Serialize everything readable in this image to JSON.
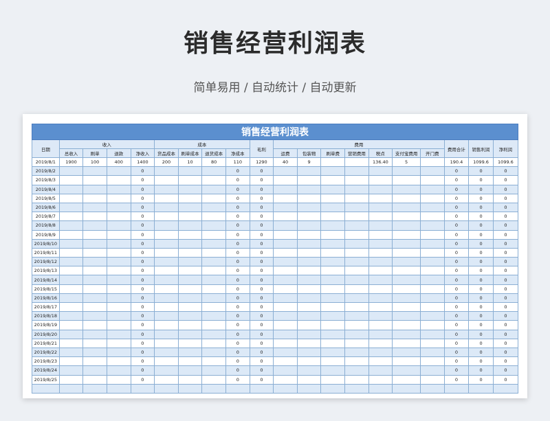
{
  "heading": "销售经营利润表",
  "subtitle": "简单易用 / 自动统计 / 自动更新",
  "table": {
    "title": "销售经营利润表",
    "groups": {
      "date": "日期",
      "income": "收入",
      "cost": "成本",
      "gross": "毛利",
      "expense": "费用",
      "expense_total": "费用合计",
      "sales_profit": "销售利润",
      "net_profit": "净利润"
    },
    "sub_headers": [
      "总收入",
      "刷单",
      "退款",
      "净收入",
      "货品成本",
      "刷单成本",
      "退货成本",
      "净成本",
      "运费",
      "包装物",
      "刷单费",
      "营销费用",
      "税点",
      "支付宝费用",
      "开门费"
    ],
    "rows": [
      [
        "2019/8/1",
        "1900",
        "100",
        "400",
        "1400",
        "200",
        "10",
        "80",
        "110",
        "1290",
        "40",
        "9",
        "",
        "",
        "136.40",
        "5",
        "",
        "190.4",
        "1099.6",
        "1099.6"
      ],
      [
        "2019/8/2",
        "",
        "",
        "",
        "0",
        "",
        "",
        "",
        "0",
        "0",
        "",
        "",
        "",
        "",
        "",
        "",
        "",
        "0",
        "0",
        "0"
      ],
      [
        "2019/8/3",
        "",
        "",
        "",
        "0",
        "",
        "",
        "",
        "0",
        "0",
        "",
        "",
        "",
        "",
        "",
        "",
        "",
        "0",
        "0",
        "0"
      ],
      [
        "2019/8/4",
        "",
        "",
        "",
        "0",
        "",
        "",
        "",
        "0",
        "0",
        "",
        "",
        "",
        "",
        "",
        "",
        "",
        "0",
        "0",
        "0"
      ],
      [
        "2019/8/5",
        "",
        "",
        "",
        "0",
        "",
        "",
        "",
        "0",
        "0",
        "",
        "",
        "",
        "",
        "",
        "",
        "",
        "0",
        "0",
        "0"
      ],
      [
        "2019/8/6",
        "",
        "",
        "",
        "0",
        "",
        "",
        "",
        "0",
        "0",
        "",
        "",
        "",
        "",
        "",
        "",
        "",
        "0",
        "0",
        "0"
      ],
      [
        "2019/8/7",
        "",
        "",
        "",
        "0",
        "",
        "",
        "",
        "0",
        "0",
        "",
        "",
        "",
        "",
        "",
        "",
        "",
        "0",
        "0",
        "0"
      ],
      [
        "2019/8/8",
        "",
        "",
        "",
        "0",
        "",
        "",
        "",
        "0",
        "0",
        "",
        "",
        "",
        "",
        "",
        "",
        "",
        "0",
        "0",
        "0"
      ],
      [
        "2019/8/9",
        "",
        "",
        "",
        "0",
        "",
        "",
        "",
        "0",
        "0",
        "",
        "",
        "",
        "",
        "",
        "",
        "",
        "0",
        "0",
        "0"
      ],
      [
        "2019/8/10",
        "",
        "",
        "",
        "0",
        "",
        "",
        "",
        "0",
        "0",
        "",
        "",
        "",
        "",
        "",
        "",
        "",
        "0",
        "0",
        "0"
      ],
      [
        "2019/8/11",
        "",
        "",
        "",
        "0",
        "",
        "",
        "",
        "0",
        "0",
        "",
        "",
        "",
        "",
        "",
        "",
        "",
        "0",
        "0",
        "0"
      ],
      [
        "2019/8/12",
        "",
        "",
        "",
        "0",
        "",
        "",
        "",
        "0",
        "0",
        "",
        "",
        "",
        "",
        "",
        "",
        "",
        "0",
        "0",
        "0"
      ],
      [
        "2019/8/13",
        "",
        "",
        "",
        "0",
        "",
        "",
        "",
        "0",
        "0",
        "",
        "",
        "",
        "",
        "",
        "",
        "",
        "0",
        "0",
        "0"
      ],
      [
        "2019/8/14",
        "",
        "",
        "",
        "0",
        "",
        "",
        "",
        "0",
        "0",
        "",
        "",
        "",
        "",
        "",
        "",
        "",
        "0",
        "0",
        "0"
      ],
      [
        "2019/8/15",
        "",
        "",
        "",
        "0",
        "",
        "",
        "",
        "0",
        "0",
        "",
        "",
        "",
        "",
        "",
        "",
        "",
        "0",
        "0",
        "0"
      ],
      [
        "2019/8/16",
        "",
        "",
        "",
        "0",
        "",
        "",
        "",
        "0",
        "0",
        "",
        "",
        "",
        "",
        "",
        "",
        "",
        "0",
        "0",
        "0"
      ],
      [
        "2019/8/17",
        "",
        "",
        "",
        "0",
        "",
        "",
        "",
        "0",
        "0",
        "",
        "",
        "",
        "",
        "",
        "",
        "",
        "0",
        "0",
        "0"
      ],
      [
        "2019/8/18",
        "",
        "",
        "",
        "0",
        "",
        "",
        "",
        "0",
        "0",
        "",
        "",
        "",
        "",
        "",
        "",
        "",
        "0",
        "0",
        "0"
      ],
      [
        "2019/8/19",
        "",
        "",
        "",
        "0",
        "",
        "",
        "",
        "0",
        "0",
        "",
        "",
        "",
        "",
        "",
        "",
        "",
        "0",
        "0",
        "0"
      ],
      [
        "2019/8/20",
        "",
        "",
        "",
        "0",
        "",
        "",
        "",
        "0",
        "0",
        "",
        "",
        "",
        "",
        "",
        "",
        "",
        "0",
        "0",
        "0"
      ],
      [
        "2019/8/21",
        "",
        "",
        "",
        "0",
        "",
        "",
        "",
        "0",
        "0",
        "",
        "",
        "",
        "",
        "",
        "",
        "",
        "0",
        "0",
        "0"
      ],
      [
        "2019/8/22",
        "",
        "",
        "",
        "0",
        "",
        "",
        "",
        "0",
        "0",
        "",
        "",
        "",
        "",
        "",
        "",
        "",
        "0",
        "0",
        "0"
      ],
      [
        "2019/8/23",
        "",
        "",
        "",
        "0",
        "",
        "",
        "",
        "0",
        "0",
        "",
        "",
        "",
        "",
        "",
        "",
        "",
        "0",
        "0",
        "0"
      ],
      [
        "2019/8/24",
        "",
        "",
        "",
        "0",
        "",
        "",
        "",
        "0",
        "0",
        "",
        "",
        "",
        "",
        "",
        "",
        "",
        "0",
        "0",
        "0"
      ],
      [
        "2019/8/25",
        "",
        "",
        "",
        "0",
        "",
        "",
        "",
        "0",
        "0",
        "",
        "",
        "",
        "",
        "",
        "",
        "",
        "0",
        "0",
        "0"
      ],
      [
        "",
        "",
        "",
        "",
        "",
        "",
        "",
        "",
        "",
        "",
        "",
        "",
        "",
        "",
        "",
        "",
        "",
        "",
        "",
        ""
      ]
    ]
  }
}
